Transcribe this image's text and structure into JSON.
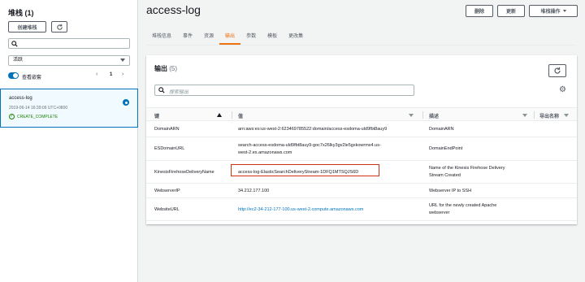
{
  "sidebar": {
    "title": "堆栈 (1)",
    "create_label": "创建堆栈",
    "search_placeholder": "",
    "filter_value": "活跃",
    "toggle_label": "查看嵌套",
    "page_number": "1",
    "stack": {
      "name": "access-log",
      "date": "2019-06-14 16:39:09 UTC+0800",
      "status": "CREATE_COMPLETE"
    }
  },
  "header": {
    "title": "access-log",
    "delete_label": "删除",
    "update_label": "更新",
    "actions_label": "堆栈操作"
  },
  "tabs": [
    "堆栈信息",
    "事件",
    "资源",
    "输出",
    "参数",
    "模板",
    "更改集"
  ],
  "active_tab": "输出",
  "outputs": {
    "title": "输出",
    "count": "(5)",
    "search_placeholder": "搜索输出",
    "columns": {
      "key": "键",
      "value": "值",
      "description": "描述",
      "export": "导出名称"
    },
    "rows": [
      {
        "key": "DomainARN",
        "value": [
          "arn:aws:es:us-west-2:623469785522:domain/access-esdoma-uld9fbt8auy9"
        ],
        "description": [
          "DomainARN"
        ],
        "link": false
      },
      {
        "key": "ESDomainURL",
        "value": [
          "search-access-esdoma-uld9fbt8auy9-goc7x26lky3gv2le5gxkowrmx4.us-",
          "west-2.es.amazonaws.com"
        ],
        "description": [
          "DomainEndPoint"
        ],
        "link": false
      },
      {
        "key": "KinesisFirehoseDeliveryName",
        "value": [
          "access-log-ElasticSearchDeliveryStream-1DFQ1MTSQJS6D"
        ],
        "description": [
          "Name of the Kinesis Firehose Delivery",
          "Stream Created"
        ],
        "link": false
      },
      {
        "key": "WebserverIP",
        "value": [
          "34.212.177.100"
        ],
        "description": [
          "Webserver IP to SSH"
        ],
        "link": false
      },
      {
        "key": "WebsiteURL",
        "value": [
          "http://ec2-34-212-177-100.us-west-2.compute.amazonaws.com"
        ],
        "description": [
          "URL for the newly created Apache",
          "webserver"
        ],
        "link": true
      }
    ]
  },
  "colors": {
    "accent": "#ec7211",
    "link": "#0073bb",
    "success": "#1d8102",
    "highlight": "#d13212"
  },
  "icons": [
    "refresh-icon",
    "search-icon",
    "chevron-left-icon",
    "chevron-right-icon",
    "gear-icon",
    "check-circle-icon"
  ]
}
